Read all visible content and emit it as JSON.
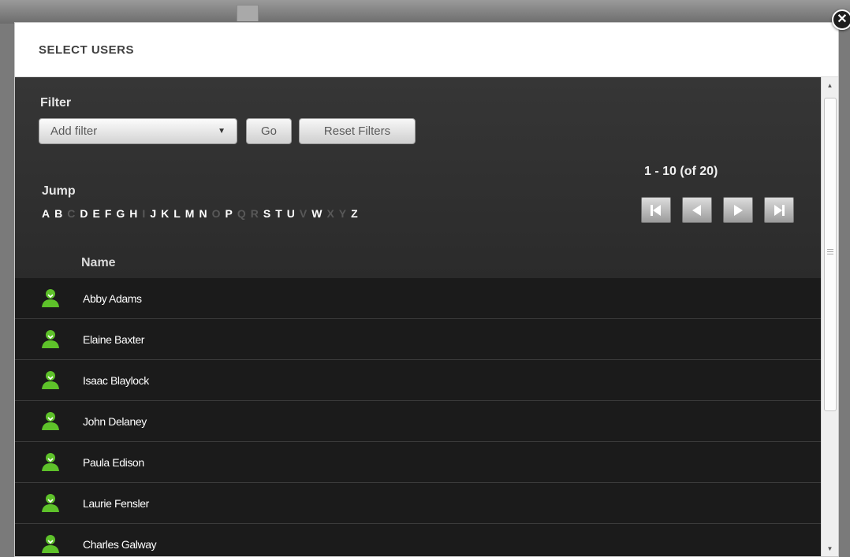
{
  "dialog": {
    "title": "SELECT USERS",
    "close_icon": "close-icon"
  },
  "filter": {
    "label": "Filter",
    "select_value": "Add filter",
    "go_label": "Go",
    "reset_label": "Reset Filters"
  },
  "jump": {
    "label": "Jump",
    "letters": [
      {
        "ch": "A",
        "enabled": true
      },
      {
        "ch": "B",
        "enabled": true
      },
      {
        "ch": "C",
        "enabled": false
      },
      {
        "ch": "D",
        "enabled": true
      },
      {
        "ch": "E",
        "enabled": true
      },
      {
        "ch": "F",
        "enabled": true
      },
      {
        "ch": "G",
        "enabled": true
      },
      {
        "ch": "H",
        "enabled": true
      },
      {
        "ch": "I",
        "enabled": false
      },
      {
        "ch": "J",
        "enabled": true
      },
      {
        "ch": "K",
        "enabled": true
      },
      {
        "ch": "L",
        "enabled": true
      },
      {
        "ch": "M",
        "enabled": true
      },
      {
        "ch": "N",
        "enabled": true
      },
      {
        "ch": "O",
        "enabled": false
      },
      {
        "ch": "P",
        "enabled": true
      },
      {
        "ch": "Q",
        "enabled": false
      },
      {
        "ch": "R",
        "enabled": false
      },
      {
        "ch": "S",
        "enabled": true
      },
      {
        "ch": "T",
        "enabled": true
      },
      {
        "ch": "U",
        "enabled": true
      },
      {
        "ch": "V",
        "enabled": false
      },
      {
        "ch": "W",
        "enabled": true
      },
      {
        "ch": "X",
        "enabled": false
      },
      {
        "ch": "Y",
        "enabled": false
      },
      {
        "ch": "Z",
        "enabled": true
      }
    ]
  },
  "pagination": {
    "range_text": "1 - 10 (of 20)",
    "buttons": [
      "first-page-icon",
      "previous-page-icon",
      "next-page-icon",
      "last-page-icon"
    ]
  },
  "table": {
    "column_header": "Name",
    "rows": [
      {
        "name": "Abby Adams",
        "icon": "user-icon"
      },
      {
        "name": "Elaine Baxter",
        "icon": "user-icon"
      },
      {
        "name": "Isaac Blaylock",
        "icon": "user-icon"
      },
      {
        "name": "John Delaney",
        "icon": "user-icon"
      },
      {
        "name": "Paula Edison",
        "icon": "user-icon"
      },
      {
        "name": "Laurie Fensler",
        "icon": "user-icon"
      },
      {
        "name": "Charles Galway",
        "icon": "user-icon"
      }
    ]
  },
  "colors": {
    "user_icon": "#5ec22a",
    "body_dark": "#2c2c2c",
    "row_bg": "#1b1b1b"
  }
}
